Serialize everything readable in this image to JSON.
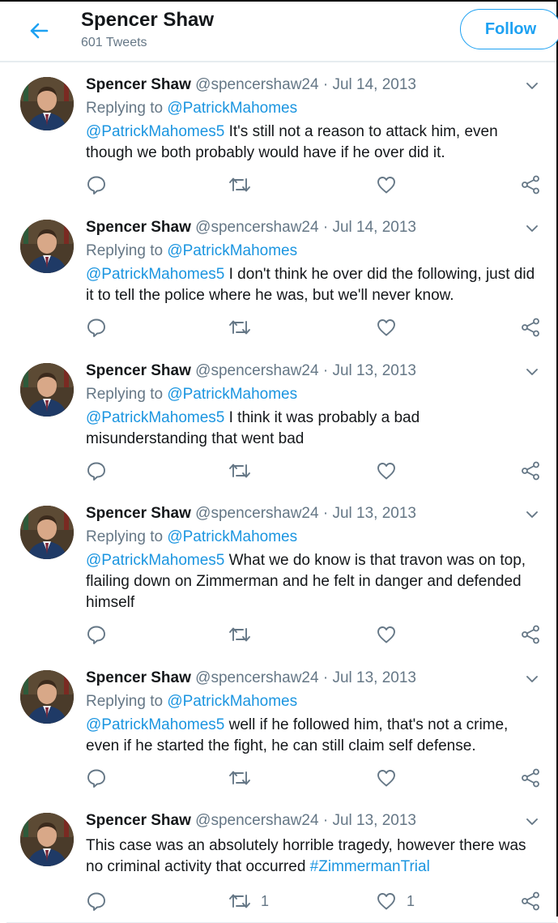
{
  "header": {
    "title": "Spencer Shaw",
    "subtitle": "601 Tweets",
    "follow_label": "Follow"
  },
  "tweets": [
    {
      "name": "Spencer Shaw",
      "handle": "@spencershaw24",
      "sep": "·",
      "date": "Jul 14, 2013",
      "reply_prefix": "Replying to",
      "reply_to": "@PatrickMahomes",
      "mention": "@PatrickMahomes5",
      "text": " It's still not a reason to attack him, even though we both probably would have if he over did it.",
      "hashtag": "",
      "retweets": "",
      "likes": ""
    },
    {
      "name": "Spencer Shaw",
      "handle": "@spencershaw24",
      "sep": "·",
      "date": "Jul 14, 2013",
      "reply_prefix": "Replying to",
      "reply_to": "@PatrickMahomes",
      "mention": "@PatrickMahomes5",
      "text": " I don't think he over did the following, just did it to tell the police where he was, but we'll never know.",
      "hashtag": "",
      "retweets": "",
      "likes": ""
    },
    {
      "name": "Spencer Shaw",
      "handle": "@spencershaw24",
      "sep": "·",
      "date": "Jul 13, 2013",
      "reply_prefix": "Replying to",
      "reply_to": "@PatrickMahomes",
      "mention": "@PatrickMahomes5",
      "text": " I think it was probably a bad misunderstanding that went bad",
      "hashtag": "",
      "retweets": "",
      "likes": ""
    },
    {
      "name": "Spencer Shaw",
      "handle": "@spencershaw24",
      "sep": "·",
      "date": "Jul 13, 2013",
      "reply_prefix": "Replying to",
      "reply_to": "@PatrickMahomes",
      "mention": "@PatrickMahomes5",
      "text": " What we do know is that travon was on top, flailing down on Zimmerman and he felt in danger and defended himself",
      "hashtag": "",
      "retweets": "",
      "likes": ""
    },
    {
      "name": "Spencer Shaw",
      "handle": "@spencershaw24",
      "sep": "·",
      "date": "Jul 13, 2013",
      "reply_prefix": "Replying to",
      "reply_to": "@PatrickMahomes",
      "mention": "@PatrickMahomes5",
      "text": " well if he followed him, that's not a crime, even if he started the fight, he can still claim self defense.",
      "hashtag": "",
      "retweets": "",
      "likes": ""
    },
    {
      "name": "Spencer Shaw",
      "handle": "@spencershaw24",
      "sep": "·",
      "date": "Jul 13, 2013",
      "reply_prefix": "",
      "reply_to": "",
      "mention": "",
      "text": "This case was an absolutely horrible tragedy, however there was no criminal activity that occurred ",
      "hashtag": "#ZimmermanTrial",
      "retweets": "1",
      "likes": "1"
    }
  ],
  "icons": {
    "back": "arrow-left-icon",
    "caret": "chevron-down-icon",
    "reply": "reply-icon",
    "retweet": "retweet-icon",
    "like": "heart-icon",
    "share": "share-icon"
  },
  "colors": {
    "accent": "#1da1f2",
    "link": "#1b95e0",
    "text": "#14171a",
    "muted": "#657786",
    "divider": "#e6ecf0"
  }
}
